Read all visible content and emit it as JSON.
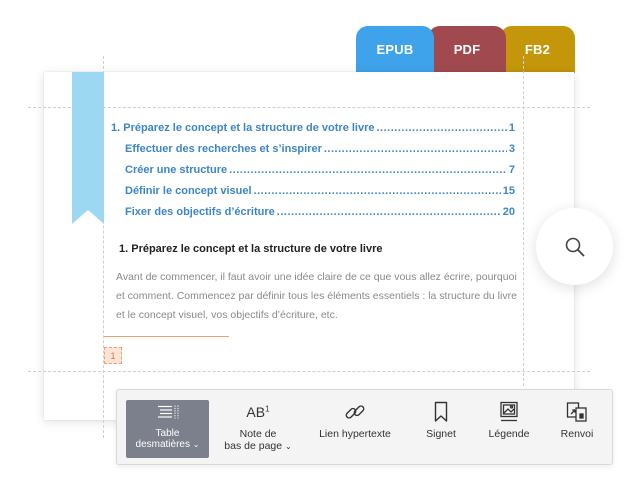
{
  "tabs": [
    {
      "label": "EPUB",
      "color": "#3ea3ea"
    },
    {
      "label": "PDF",
      "color": "#a04a4f"
    },
    {
      "label": "FB2",
      "color": "#c4960a"
    }
  ],
  "toc": [
    {
      "title": "1. Préparez le concept et la structure de votre livre",
      "page": "1",
      "level": 1
    },
    {
      "title": "Effectuer des recherches et s’inspirer",
      "page": "3",
      "level": 2
    },
    {
      "title": "Créer une structure",
      "page": "7",
      "level": 2
    },
    {
      "title": "Définir le concept visuel",
      "page": "15",
      "level": 2
    },
    {
      "title": "Fixer des objectifs d’écriture",
      "page": "20",
      "level": 2
    }
  ],
  "document": {
    "heading": "1. Préparez le concept et la structure de votre livre",
    "body": "Avant de commencer, il faut avoir une idée claire de ce que vous allez écrire, pourquoi et comment. Commencez par définir tous les éléments essentiels : la structure du livre et le concept visuel, vos objectifs d’écriture, etc.",
    "footnote_number": "1"
  },
  "toolbar": {
    "toc": {
      "line1": "Table",
      "line2": "desmatières",
      "caret": "⌄"
    },
    "footnote": {
      "icon_text": "AB",
      "icon_sup": "1",
      "line1": "Note de",
      "line2": "bas de page",
      "caret": "⌄"
    },
    "hyperlink": "Lien hypertexte",
    "bookmark": "Signet",
    "caption": "Légende",
    "crossref": "Renvoi"
  },
  "colors": {
    "toc_link": "#3d86c6",
    "bookmark_ribbon": "#9dd8f2",
    "active_tool": "#7c7f8c",
    "footnote_accent": "#f0a070"
  },
  "icons": [
    "bookmark-ribbon",
    "search-icon",
    "table-of-contents-icon",
    "footnote-icon",
    "link-icon",
    "bookmark-icon",
    "image-caption-icon",
    "cross-reference-icon"
  ]
}
